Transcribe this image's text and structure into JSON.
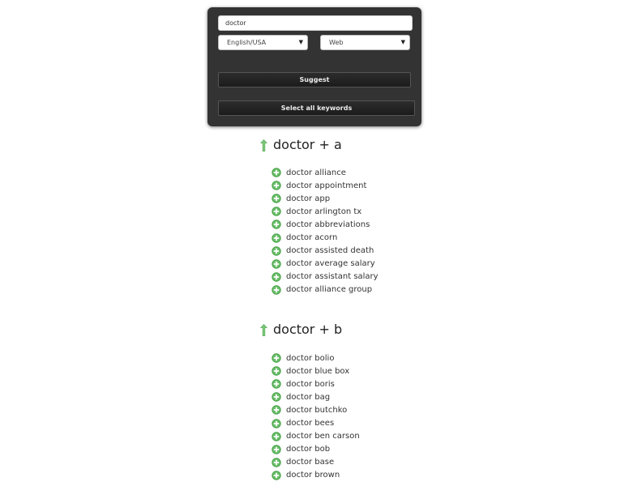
{
  "search": {
    "value": "doctor"
  },
  "language_select": {
    "selected": "English/USA"
  },
  "source_select": {
    "selected": "Web"
  },
  "buttons": {
    "suggest": "Suggest",
    "select_all": "Select all keywords"
  },
  "colors": {
    "panel_bg": "#333333",
    "arrow_green": "#5cae5c",
    "plus_green": "#4aa34a"
  },
  "icons": {
    "group_arrow": "up-arrow-icon",
    "add_keyword": "plus-circle-icon"
  },
  "groups": [
    {
      "title": "doctor + a",
      "keywords": [
        "doctor alliance",
        "doctor appointment",
        "doctor app",
        "doctor arlington tx",
        "doctor abbreviations",
        "doctor acorn",
        "doctor assisted death",
        "doctor average salary",
        "doctor assistant salary",
        "doctor alliance group"
      ]
    },
    {
      "title": "doctor + b",
      "keywords": [
        "doctor bolio",
        "doctor blue box",
        "doctor boris",
        "doctor bag",
        "doctor butchko",
        "doctor bees",
        "doctor ben carson",
        "doctor bob",
        "doctor base",
        "doctor brown"
      ]
    }
  ]
}
